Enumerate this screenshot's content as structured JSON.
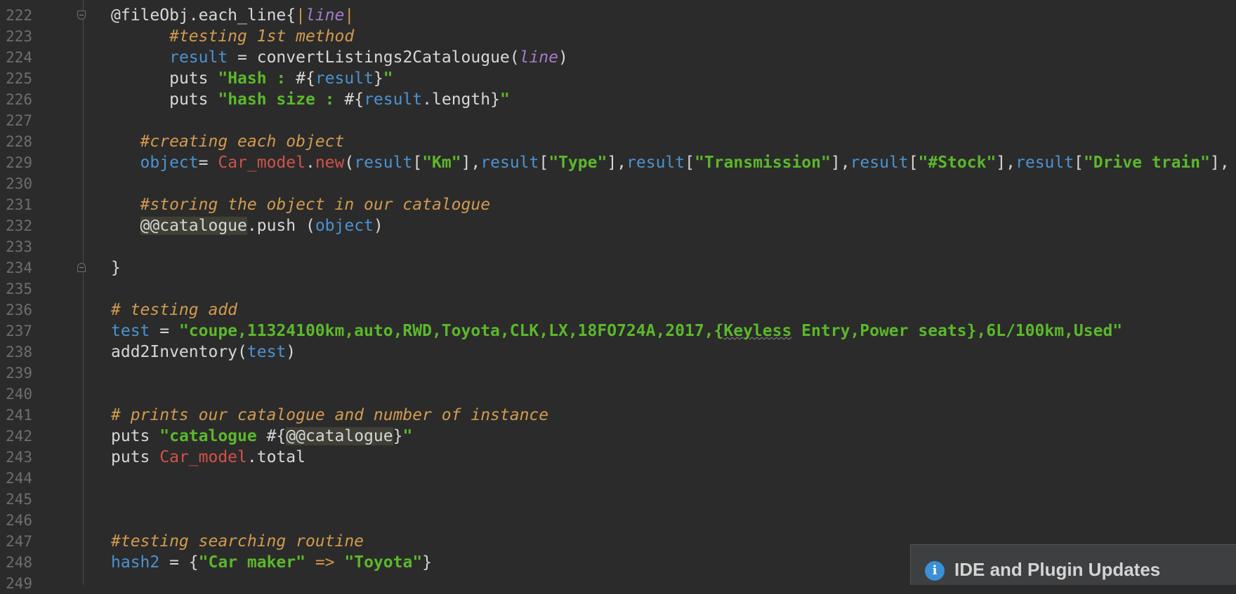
{
  "editor": {
    "lines": [
      {
        "num": "222",
        "fold": "start",
        "indent": "",
        "tokens": [
          [
            "default",
            "@fileObj"
          ],
          [
            "punct",
            "."
          ],
          [
            "default",
            "each_line"
          ],
          [
            "punct",
            "{"
          ],
          [
            "sym",
            "|"
          ],
          [
            "param",
            "line"
          ],
          [
            "sym",
            "|"
          ]
        ]
      },
      {
        "num": "223",
        "indent": "      ",
        "tokens": [
          [
            "cmt",
            "#testing 1st method"
          ]
        ]
      },
      {
        "num": "224",
        "indent": "      ",
        "tokens": [
          [
            "var",
            "result"
          ],
          [
            "default",
            " = "
          ],
          [
            "default",
            "convertListings2Catalougue("
          ],
          [
            "param",
            "line"
          ],
          [
            "default",
            ")"
          ]
        ]
      },
      {
        "num": "225",
        "indent": "      ",
        "tokens": [
          [
            "default",
            "puts "
          ],
          [
            "str",
            "\"Hash : "
          ],
          [
            "default",
            "#{"
          ],
          [
            "var",
            "result"
          ],
          [
            "default",
            "}"
          ],
          [
            "str",
            "\""
          ]
        ]
      },
      {
        "num": "226",
        "indent": "      ",
        "tokens": [
          [
            "default",
            "puts "
          ],
          [
            "str",
            "\"hash size : "
          ],
          [
            "default",
            "#{"
          ],
          [
            "var",
            "result"
          ],
          [
            "default",
            ".length}"
          ],
          [
            "str",
            "\""
          ]
        ]
      },
      {
        "num": "227",
        "indent": "",
        "tokens": []
      },
      {
        "num": "228",
        "indent": "   ",
        "tokens": [
          [
            "cmt",
            "#creating each object"
          ]
        ]
      },
      {
        "num": "229",
        "indent": "   ",
        "tokens": [
          [
            "var",
            "object"
          ],
          [
            "default",
            "= "
          ],
          [
            "const",
            "Car_model"
          ],
          [
            "default",
            "."
          ],
          [
            "const",
            "new"
          ],
          [
            "default",
            "("
          ],
          [
            "var",
            "result"
          ],
          [
            "default",
            "["
          ],
          [
            "str",
            "\"Km\""
          ],
          [
            "default",
            "],"
          ],
          [
            "var",
            "result"
          ],
          [
            "default",
            "["
          ],
          [
            "str",
            "\"Type\""
          ],
          [
            "default",
            "],"
          ],
          [
            "var",
            "result"
          ],
          [
            "default",
            "["
          ],
          [
            "str",
            "\"Transmission\""
          ],
          [
            "default",
            "],"
          ],
          [
            "var",
            "result"
          ],
          [
            "default",
            "["
          ],
          [
            "str",
            "\"#Stock\""
          ],
          [
            "default",
            "],"
          ],
          [
            "var",
            "result"
          ],
          [
            "default",
            "["
          ],
          [
            "str",
            "\"Drive train\""
          ],
          [
            "default",
            "],"
          ]
        ]
      },
      {
        "num": "230",
        "indent": "",
        "tokens": []
      },
      {
        "num": "231",
        "indent": "   ",
        "tokens": [
          [
            "cmt",
            "#storing the object in our catalogue"
          ]
        ]
      },
      {
        "num": "232",
        "indent": "   ",
        "tokens": [
          [
            "hl",
            "@@catalogue"
          ],
          [
            "default",
            ".push ("
          ],
          [
            "var",
            "object"
          ],
          [
            "default",
            ")"
          ]
        ]
      },
      {
        "num": "233",
        "indent": "",
        "tokens": []
      },
      {
        "num": "234",
        "fold": "end",
        "indent": "",
        "tokens": [
          [
            "default",
            "}"
          ]
        ]
      },
      {
        "num": "235",
        "indent": "",
        "tokens": []
      },
      {
        "num": "236",
        "indent": "",
        "tokens": [
          [
            "cmt",
            "# testing add"
          ]
        ]
      },
      {
        "num": "237",
        "indent": "",
        "tokens": [
          [
            "var",
            "test"
          ],
          [
            "default",
            " = "
          ],
          [
            "str",
            "\"coupe,11324100km,auto,RWD,Toyota,CLK,LX,18FO724A,2017,{"
          ],
          [
            "squig",
            "Keyless"
          ],
          [
            "str",
            " Entry,Power seats},6L/100km,Used\""
          ]
        ]
      },
      {
        "num": "238",
        "indent": "",
        "tokens": [
          [
            "default",
            "add2Inventory("
          ],
          [
            "var",
            "test"
          ],
          [
            "default",
            ")"
          ]
        ]
      },
      {
        "num": "239",
        "indent": "",
        "tokens": []
      },
      {
        "num": "240",
        "indent": "",
        "tokens": []
      },
      {
        "num": "241",
        "indent": "",
        "tokens": [
          [
            "cmt",
            "# prints our catalogue and number of instance"
          ]
        ]
      },
      {
        "num": "242",
        "indent": "",
        "tokens": [
          [
            "default",
            "puts "
          ],
          [
            "str",
            "\"catalogue "
          ],
          [
            "default",
            "#{"
          ],
          [
            "hl",
            "@@catalogue"
          ],
          [
            "default",
            "}"
          ],
          [
            "str",
            "\""
          ]
        ]
      },
      {
        "num": "243",
        "indent": "",
        "tokens": [
          [
            "default",
            "puts "
          ],
          [
            "const",
            "Car_model"
          ],
          [
            "default",
            ".total"
          ]
        ]
      },
      {
        "num": "244",
        "indent": "",
        "tokens": []
      },
      {
        "num": "245",
        "indent": "",
        "tokens": []
      },
      {
        "num": "246",
        "indent": "",
        "tokens": []
      },
      {
        "num": "247",
        "indent": "",
        "tokens": [
          [
            "cmt",
            "#testing searching routine"
          ]
        ]
      },
      {
        "num": "248",
        "indent": "",
        "tokens": [
          [
            "var",
            "hash2"
          ],
          [
            "default",
            " = {"
          ],
          [
            "str",
            "\"Car maker\""
          ],
          [
            "default",
            " "
          ],
          [
            "sym",
            "=>"
          ],
          [
            "default",
            " "
          ],
          [
            "str",
            "\"Toyota\""
          ],
          [
            "default",
            "}"
          ]
        ]
      },
      {
        "num": "249",
        "indent": "",
        "tokens": []
      }
    ]
  },
  "notification": {
    "icon": "info-icon",
    "title": "IDE and Plugin Updates"
  },
  "colors": {
    "background": "#2b2b2b",
    "variable": "#4b93d1",
    "string": "#5bb82a",
    "comment": "#d29b4f",
    "constant": "#d2524a",
    "parameter": "#a57bc9"
  }
}
